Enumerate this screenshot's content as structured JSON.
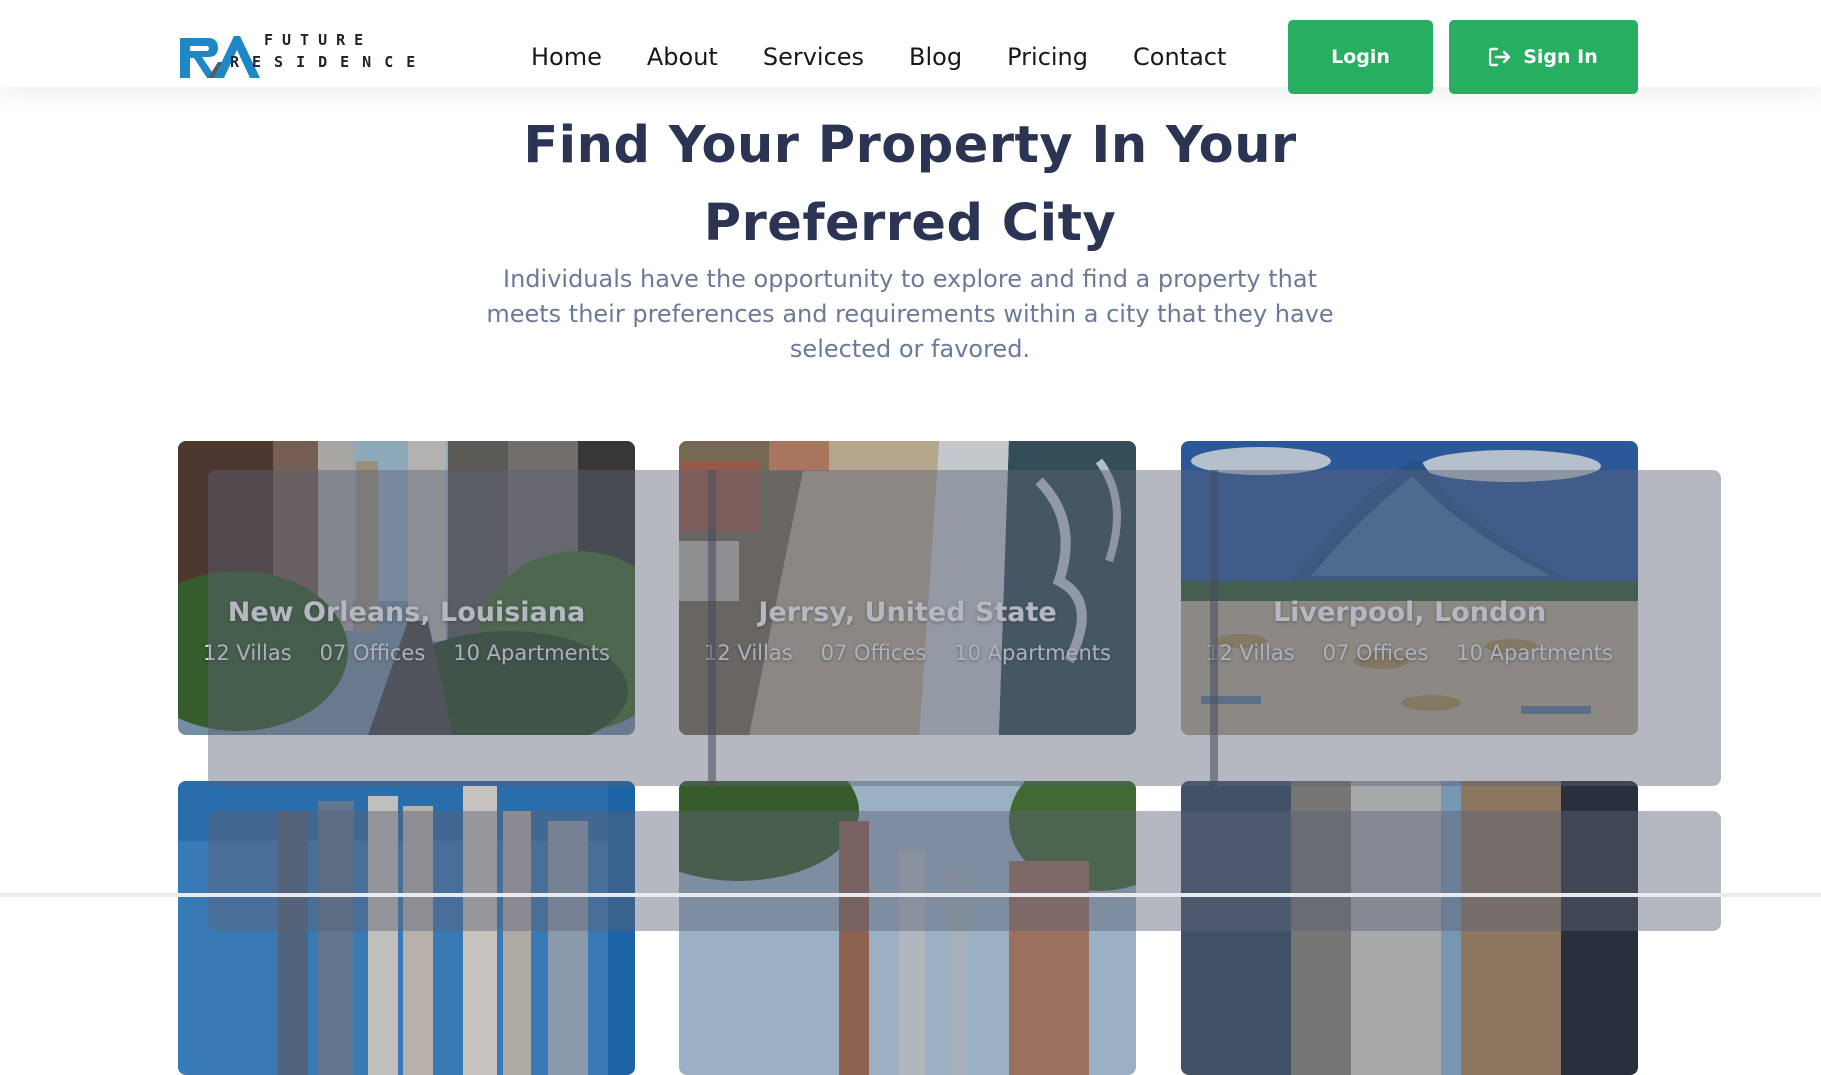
{
  "brand": {
    "line1": "FUTURE",
    "line2": "RESIDENCE",
    "accent": "#1e88c7",
    "dark": "#1d2230"
  },
  "nav": {
    "items": [
      "Home",
      "About",
      "Services",
      "Blog",
      "Pricing",
      "Contact"
    ]
  },
  "auth": {
    "login_label": "Login",
    "signin_label": "Sign In",
    "signin_icon": "sign-in-icon",
    "button_color": "#27ae60"
  },
  "hero": {
    "title_line1": "Find Your Property In Your",
    "title_line2": "Preferred City",
    "subtitle": "Individuals have the opportunity to explore and find a property that meets their preferences and requirements within a city that they have selected or favored."
  },
  "cities": [
    {
      "name": "New Orleans, Louisiana",
      "villas": "12 Villas",
      "offices": "07 Offices",
      "apartments": "10 Apartments"
    },
    {
      "name": "Jerrsy, United State",
      "villas": "12 Villas",
      "offices": "07 Offices",
      "apartments": "10 Apartments"
    },
    {
      "name": "Liverpool, London",
      "villas": "12 Villas",
      "offices": "07 Offices",
      "apartments": "10 Apartments"
    },
    {
      "name": "",
      "villas": "",
      "offices": "",
      "apartments": ""
    },
    {
      "name": "",
      "villas": "",
      "offices": "",
      "apartments": ""
    },
    {
      "name": "",
      "villas": "",
      "offices": "",
      "apartments": ""
    }
  ]
}
